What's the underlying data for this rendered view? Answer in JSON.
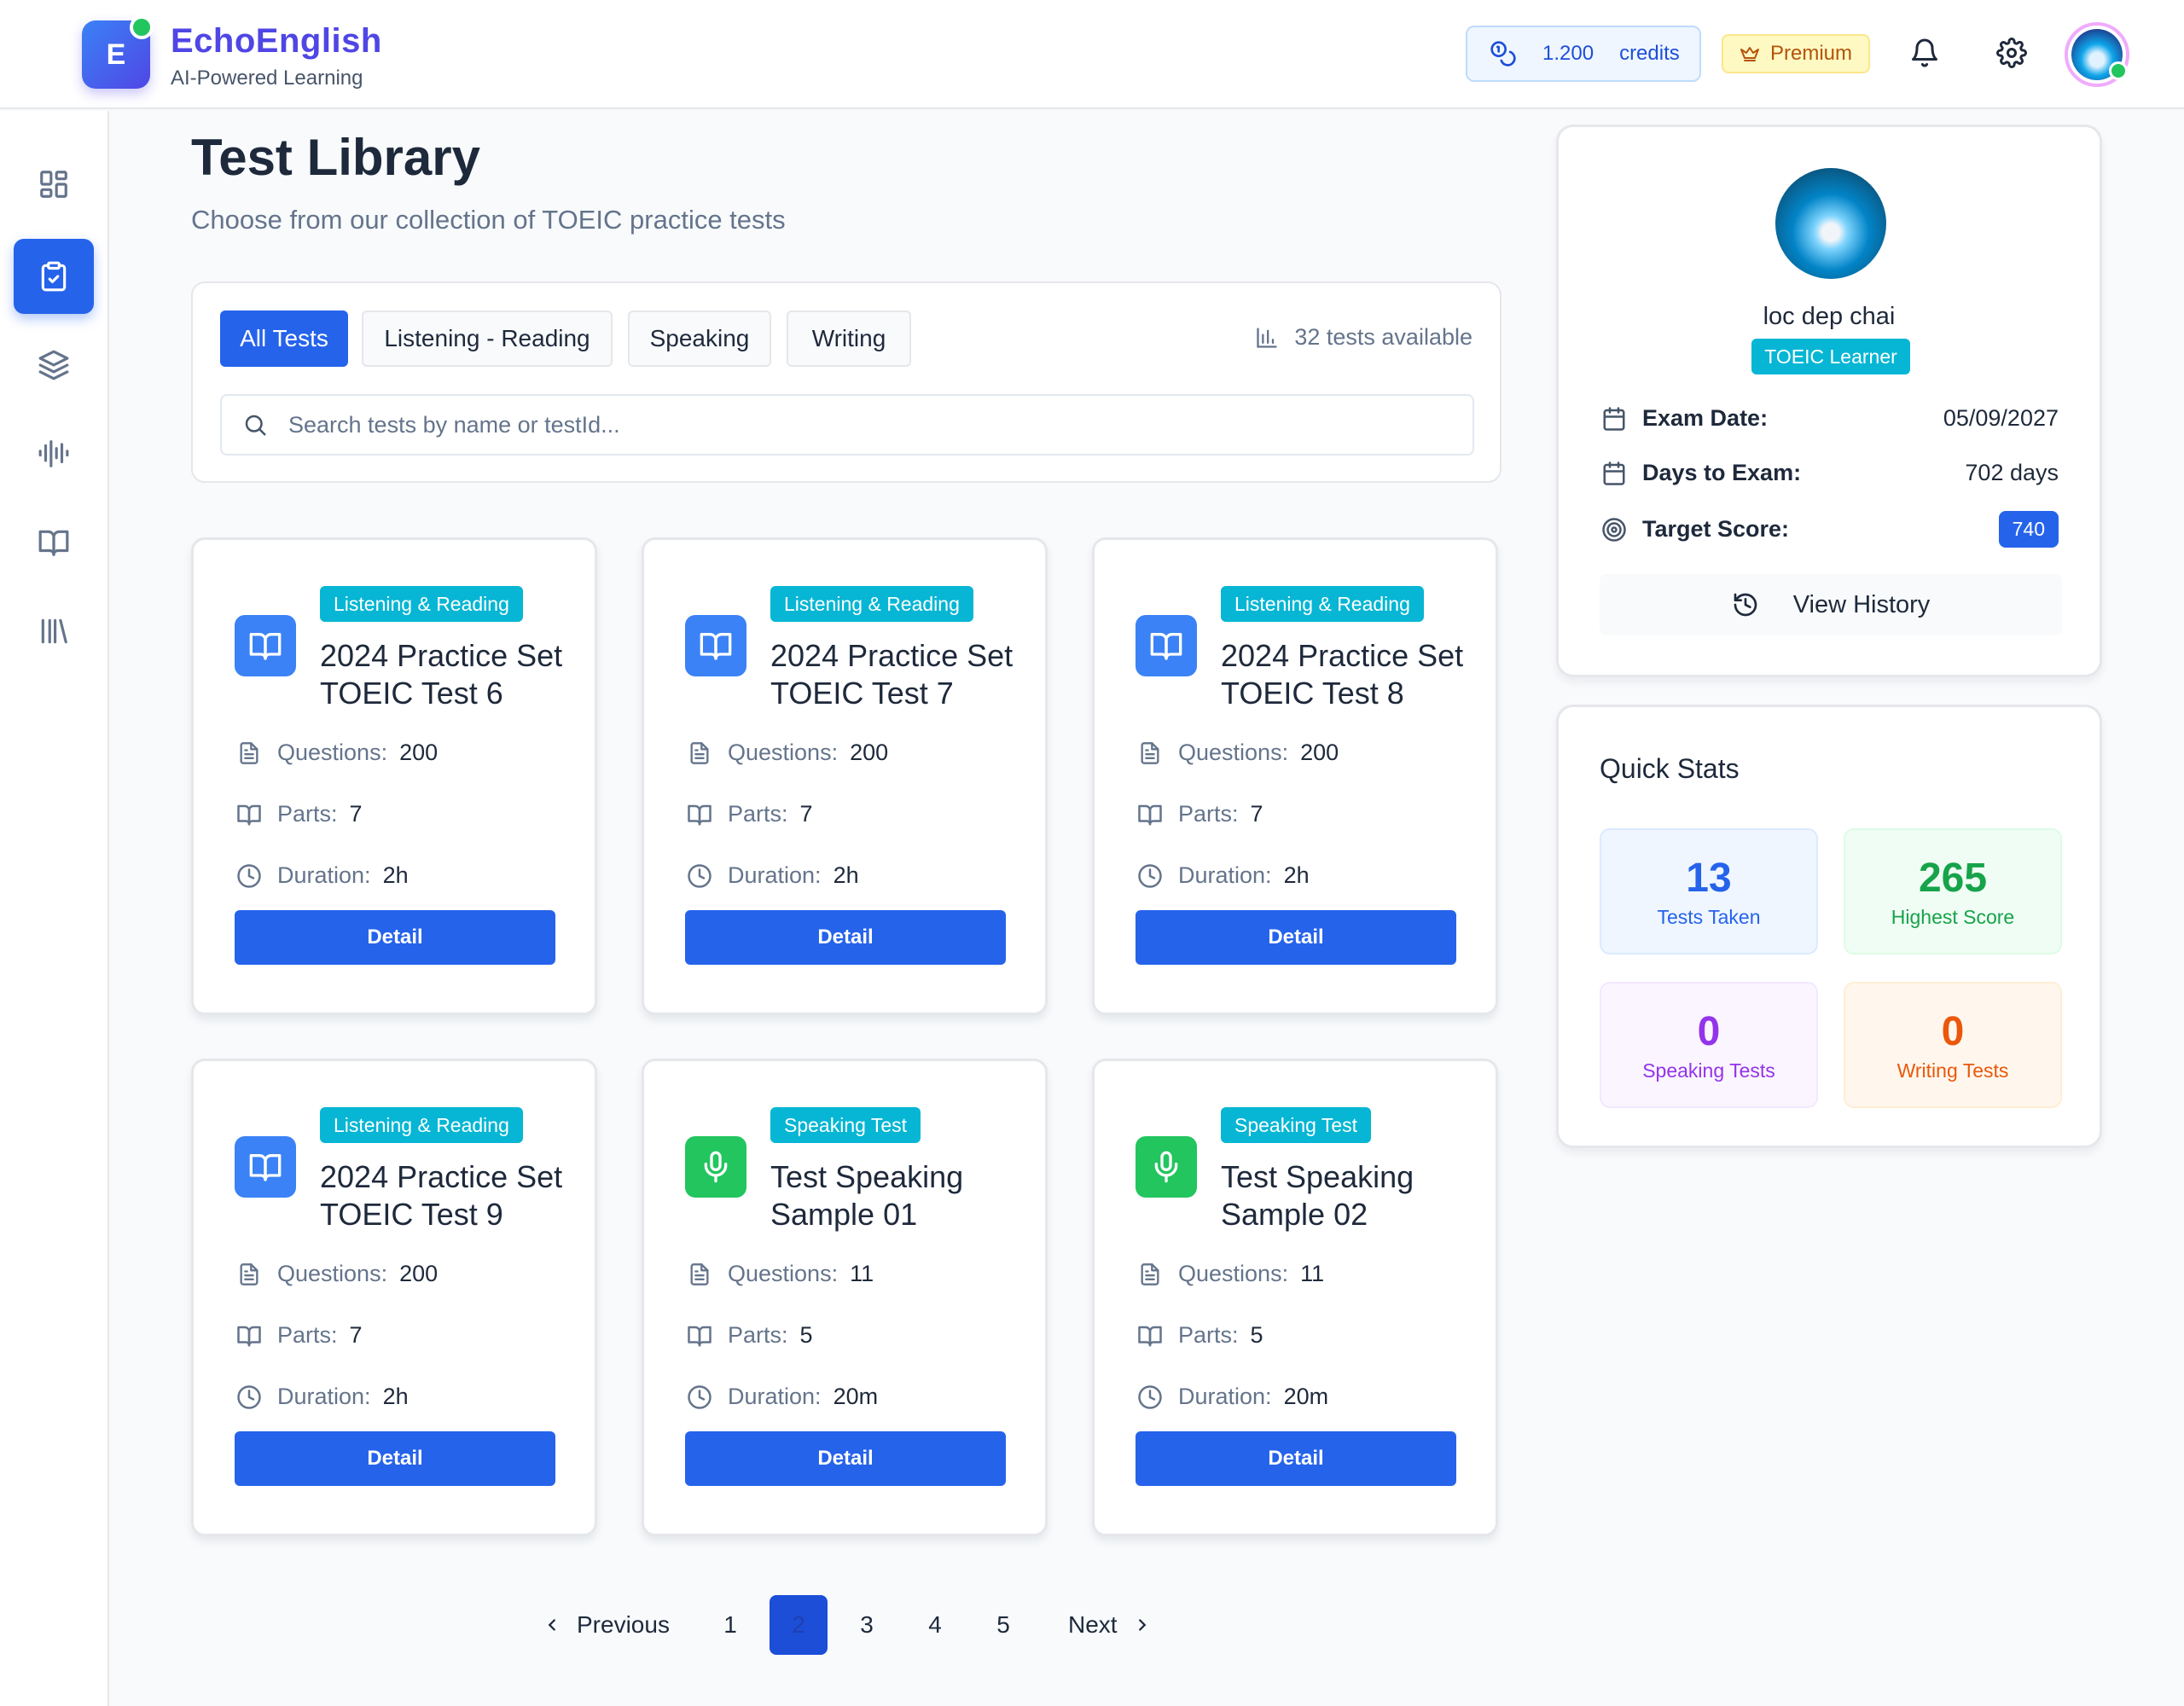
{
  "app": {
    "logo_letter": "E",
    "name": "EchoEnglish",
    "tagline": "AI-Powered Learning"
  },
  "header": {
    "credits_amount": "1.200",
    "credits_label": "credits",
    "premium_label": "Premium"
  },
  "sidebar": {
    "items": [
      {
        "name": "dashboard",
        "icon": "grid-icon",
        "active": false
      },
      {
        "name": "tests",
        "icon": "clipboard-check-icon",
        "active": true
      },
      {
        "name": "flashcards",
        "icon": "layers-icon",
        "active": false
      },
      {
        "name": "speaking",
        "icon": "audio-wave-icon",
        "active": false
      },
      {
        "name": "reading",
        "icon": "book-open-icon",
        "active": false
      },
      {
        "name": "library",
        "icon": "library-icon",
        "active": false
      }
    ]
  },
  "main": {
    "title": "Test Library",
    "subtitle": "Choose from our collection of TOEIC practice tests",
    "tabs": [
      {
        "label": "All Tests",
        "active": true
      },
      {
        "label": "Listening - Reading",
        "active": false
      },
      {
        "label": "Speaking",
        "active": false
      },
      {
        "label": "Writing",
        "active": false
      }
    ],
    "tests_available": "32 tests available",
    "search_placeholder": "Search tests by name or testId...",
    "labels": {
      "questions": "Questions:",
      "parts": "Parts:",
      "duration": "Duration:",
      "detail": "Detail"
    },
    "tests": [
      {
        "badge": "Listening & Reading",
        "title": "2024 Practice Set TOEIC Test 6",
        "questions": "200",
        "parts": "7",
        "duration": "2h",
        "icon": "book-open-icon"
      },
      {
        "badge": "Listening & Reading",
        "title": "2024 Practice Set TOEIC Test 7",
        "questions": "200",
        "parts": "7",
        "duration": "2h",
        "icon": "book-open-icon"
      },
      {
        "badge": "Listening & Reading",
        "title": "2024 Practice Set TOEIC Test 8",
        "questions": "200",
        "parts": "7",
        "duration": "2h",
        "icon": "book-open-icon"
      },
      {
        "badge": "Listening & Reading",
        "title": "2024 Practice Set TOEIC Test 9",
        "questions": "200",
        "parts": "7",
        "duration": "2h",
        "icon": "book-open-icon"
      },
      {
        "badge": "Speaking Test",
        "title": "Test Speaking Sample 01",
        "questions": "11",
        "parts": "5",
        "duration": "20m",
        "icon": "microphone-icon"
      },
      {
        "badge": "Speaking Test",
        "title": "Test Speaking Sample 02",
        "questions": "11",
        "parts": "5",
        "duration": "20m",
        "icon": "microphone-icon"
      }
    ],
    "pagination": {
      "previous": "Previous",
      "next": "Next",
      "pages": [
        "1",
        "2",
        "3",
        "4",
        "5"
      ],
      "current": "2"
    }
  },
  "profile": {
    "name": "loc dep chai",
    "role_badge": "TOEIC Learner",
    "exam_date_label": "Exam Date:",
    "exam_date": "05/09/2027",
    "days_label": "Days to Exam:",
    "days_value": "702 days",
    "target_label": "Target Score:",
    "target_value": "740",
    "history_button": "View History"
  },
  "quick_stats": {
    "title": "Quick Stats",
    "items": [
      {
        "value": "13",
        "label": "Tests Taken",
        "color": "#2563eb",
        "bg": "#eff6ff",
        "border": "#dbeafe"
      },
      {
        "value": "265",
        "label": "Highest Score",
        "color": "#16a34a",
        "bg": "#f0fdf4",
        "border": "#dcfce7"
      },
      {
        "value": "0",
        "label": "Speaking Tests",
        "color": "#9333ea",
        "bg": "#faf5ff",
        "border": "#f3e8ff"
      },
      {
        "value": "0",
        "label": "Writing Tests",
        "color": "#ea580c",
        "bg": "#fff7ed",
        "border": "#ffedd5"
      }
    ]
  }
}
